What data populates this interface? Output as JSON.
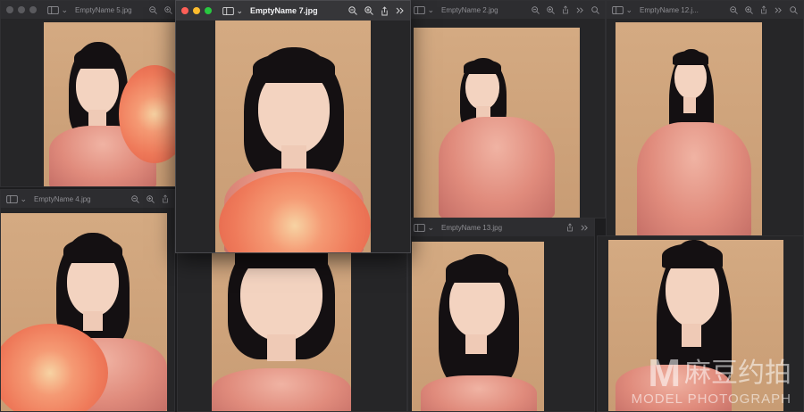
{
  "windows": [
    {
      "title": "EmptyName 5.jpg"
    },
    {
      "title": "EmptyName 7.jpg"
    },
    {
      "title": "EmptyName 2.jpg"
    },
    {
      "title": "EmptyName 12.j..."
    },
    {
      "title": "EmptyName 4.jpg"
    },
    {
      "title": "EmptyName 13.jpg"
    }
  ],
  "watermark": {
    "logo_letter": "M",
    "brand_cn": "麻豆约拍",
    "brand_en": "MODEL PHOTOGRAPH"
  },
  "icons": [
    "sidebar-icon",
    "zoom-out-icon",
    "zoom-in-icon",
    "share-icon",
    "more-icon",
    "search-icon"
  ],
  "colors": {
    "background": "#1d1d1f",
    "photo_backdrop": "#d4aa82",
    "dress": "#e08b7c",
    "flower": "#ef7a5a"
  }
}
